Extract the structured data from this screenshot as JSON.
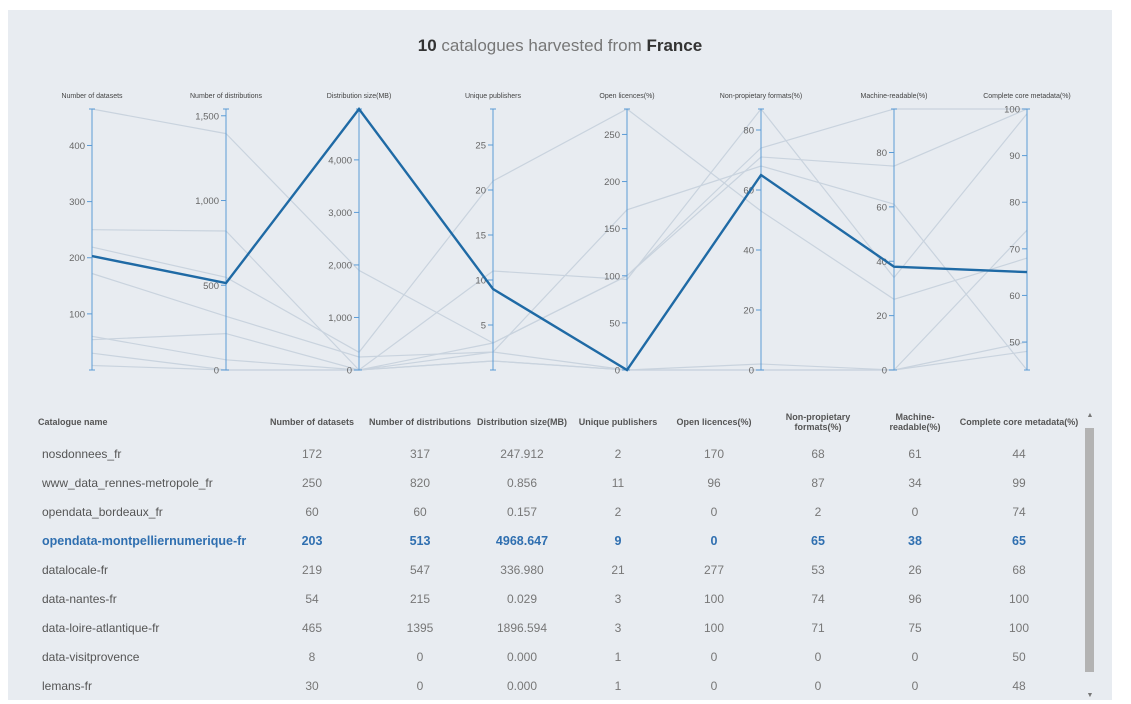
{
  "header": {
    "count": "10",
    "middle": " catalogues harvested from ",
    "country": "France"
  },
  "chart_data": {
    "type": "parallel-coordinates",
    "axes": [
      {
        "label": "Number of datasets",
        "range": [
          0,
          465
        ],
        "ticks": [
          100,
          200,
          300,
          400
        ]
      },
      {
        "label": "Number of distributions",
        "range": [
          0,
          1540
        ],
        "ticks": [
          0,
          500,
          1000,
          1500
        ],
        "tick_labels": [
          "0",
          "500",
          "1,000",
          "1,500"
        ]
      },
      {
        "label": "Distribution size(MB)",
        "range": [
          0,
          4968.647
        ],
        "ticks": [
          0,
          1000,
          2000,
          3000,
          4000
        ],
        "tick_labels": [
          "0",
          "1,000",
          "2,000",
          "3,000",
          "4,000"
        ]
      },
      {
        "label": "Unique publishers",
        "range": [
          0,
          29
        ],
        "ticks": [
          5,
          10,
          15,
          20,
          25
        ]
      },
      {
        "label": "Open licences(%)",
        "range": [
          0,
          277
        ],
        "ticks": [
          0,
          50,
          100,
          150,
          200,
          250
        ]
      },
      {
        "label": "Non-propietary formats(%)",
        "range": [
          0,
          87
        ],
        "ticks": [
          0,
          20,
          40,
          60,
          80
        ]
      },
      {
        "label": "Machine-readable(%)",
        "range": [
          0,
          96
        ],
        "ticks": [
          0,
          20,
          40,
          60,
          80
        ]
      },
      {
        "label": "Complete core metadata(%)",
        "range": [
          44,
          100
        ],
        "ticks": [
          50,
          60,
          70,
          80,
          90,
          100
        ]
      }
    ],
    "series": [
      {
        "name": "nosdonnees_fr",
        "values": [
          172,
          317,
          247.912,
          2,
          170,
          68,
          61,
          44
        ]
      },
      {
        "name": "www_data_rennes-metropole_fr",
        "values": [
          250,
          820,
          0.856,
          11,
          96,
          87,
          34,
          99
        ]
      },
      {
        "name": "opendata_bordeaux_fr",
        "values": [
          60,
          60,
          0.157,
          2,
          0,
          2,
          0,
          74
        ]
      },
      {
        "name": "opendata-montpelliernumerique-fr",
        "values": [
          203,
          513,
          4968.647,
          9,
          0,
          65,
          38,
          65
        ],
        "highlight": true
      },
      {
        "name": "datalocale-fr",
        "values": [
          219,
          547,
          336.98,
          21,
          277,
          53,
          26,
          68
        ]
      },
      {
        "name": "data-nantes-fr",
        "values": [
          54,
          215,
          0.029,
          3,
          100,
          74,
          96,
          100
        ]
      },
      {
        "name": "data-loire-atlantique-fr",
        "values": [
          465,
          1395,
          1896.594,
          3,
          100,
          71,
          75,
          100
        ]
      },
      {
        "name": "data-visitprovence",
        "values": [
          8,
          0,
          0.0,
          1,
          0,
          0,
          0,
          50
        ]
      },
      {
        "name": "lemans-fr",
        "values": [
          30,
          0,
          0.0,
          1,
          0,
          0,
          0,
          48
        ]
      }
    ],
    "colors": {
      "highlight": "#1f6aa5",
      "background": "#c9d3de",
      "axis": "#5b9bd5"
    }
  },
  "table": {
    "headers": [
      "Catalogue name",
      "Number of datasets",
      "Number of distributions",
      "Distribution size(MB)",
      "Unique publishers",
      "Open licences(%)",
      "Non-propietary formats(%)",
      "Machine-readable(%)",
      "Complete core metadata(%)"
    ],
    "rows": [
      [
        "nosdonnees_fr",
        "172",
        "317",
        "247.912",
        "2",
        "170",
        "68",
        "61",
        "44"
      ],
      [
        "www_data_rennes-metropole_fr",
        "250",
        "820",
        "0.856",
        "11",
        "96",
        "87",
        "34",
        "99"
      ],
      [
        "opendata_bordeaux_fr",
        "60",
        "60",
        "0.157",
        "2",
        "0",
        "2",
        "0",
        "74"
      ],
      [
        "opendata-montpelliernumerique-fr",
        "203",
        "513",
        "4968.647",
        "9",
        "0",
        "65",
        "38",
        "65"
      ],
      [
        "datalocale-fr",
        "219",
        "547",
        "336.980",
        "21",
        "277",
        "53",
        "26",
        "68"
      ],
      [
        "data-nantes-fr",
        "54",
        "215",
        "0.029",
        "3",
        "100",
        "74",
        "96",
        "100"
      ],
      [
        "data-loire-atlantique-fr",
        "465",
        "1395",
        "1896.594",
        "3",
        "100",
        "71",
        "75",
        "100"
      ],
      [
        "data-visitprovence",
        "8",
        "0",
        "0.000",
        "1",
        "0",
        "0",
        "0",
        "50"
      ],
      [
        "lemans-fr",
        "30",
        "0",
        "0.000",
        "1",
        "0",
        "0",
        "0",
        "48"
      ]
    ],
    "highlight_row": 3
  },
  "scrollbar": {
    "up": "▲",
    "down": "▼"
  }
}
